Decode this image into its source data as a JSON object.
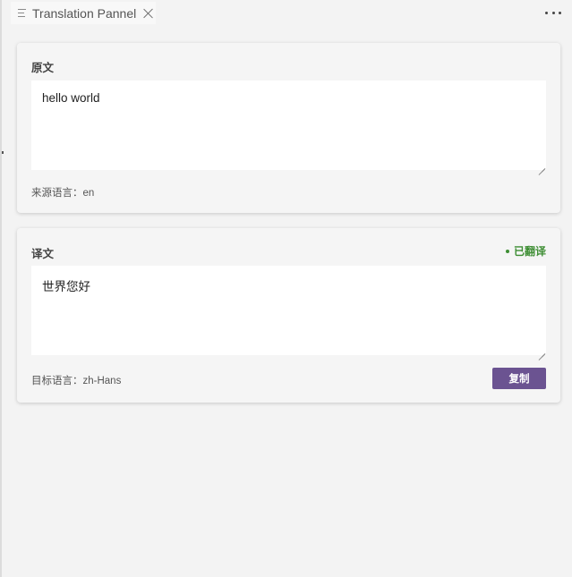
{
  "tab": {
    "title": "Translation Pannel"
  },
  "source": {
    "title": "原文",
    "text": "hello world",
    "language_label": "来源语言：en"
  },
  "target": {
    "title": "译文",
    "status": "已翻译",
    "text": "世界您好",
    "language_label": "目标语言：zh-Hans",
    "copy_label": "复制"
  },
  "colors": {
    "accent": "#6b5391",
    "status": "#3e8e34",
    "background": "#f3f3f3"
  }
}
